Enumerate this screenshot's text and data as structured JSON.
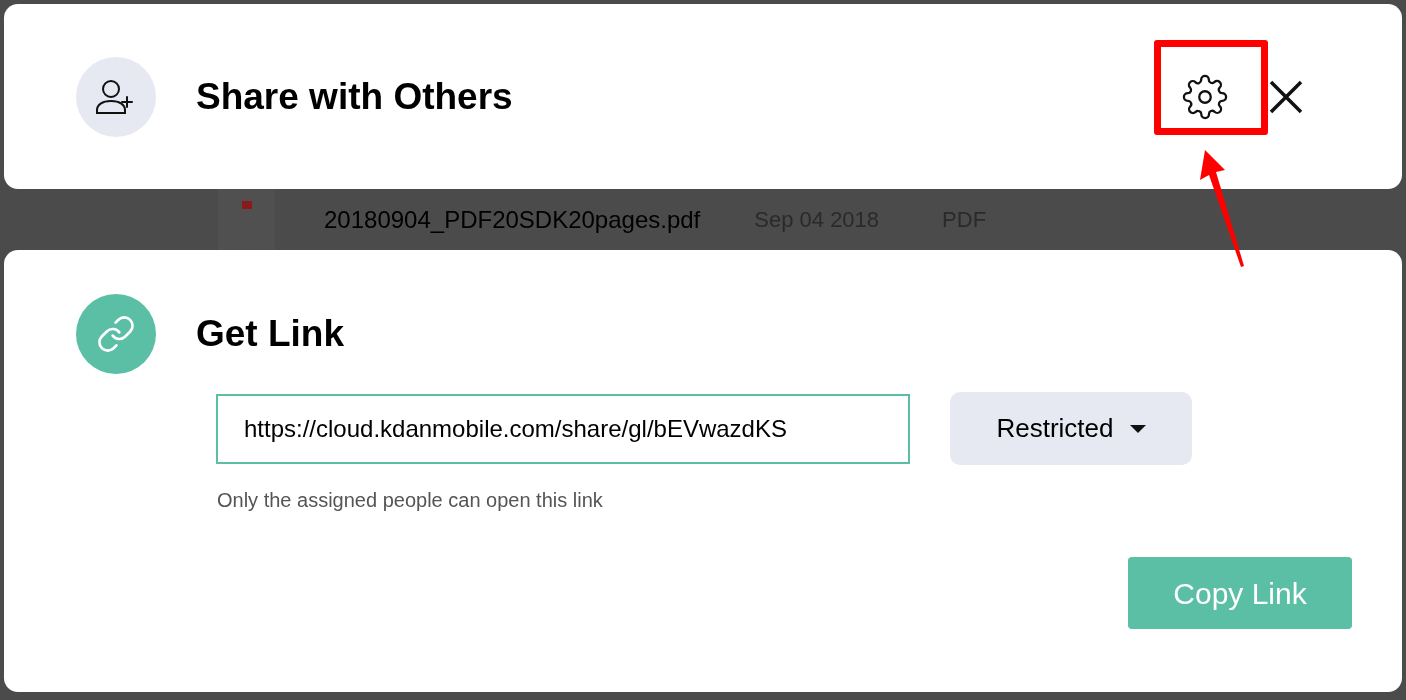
{
  "dialog": {
    "title": "Share with Others"
  },
  "background_file": {
    "name": "20180904_PDF20SDK20pages.pdf",
    "date": "Sep 04 2018",
    "type": "PDF"
  },
  "get_link": {
    "title": "Get Link",
    "url": "https://cloud.kdanmobile.com/share/gl/bEVwazdKS",
    "access": "Restricted",
    "hint": "Only the assigned people can open this link",
    "copy_button": "Copy Link"
  }
}
